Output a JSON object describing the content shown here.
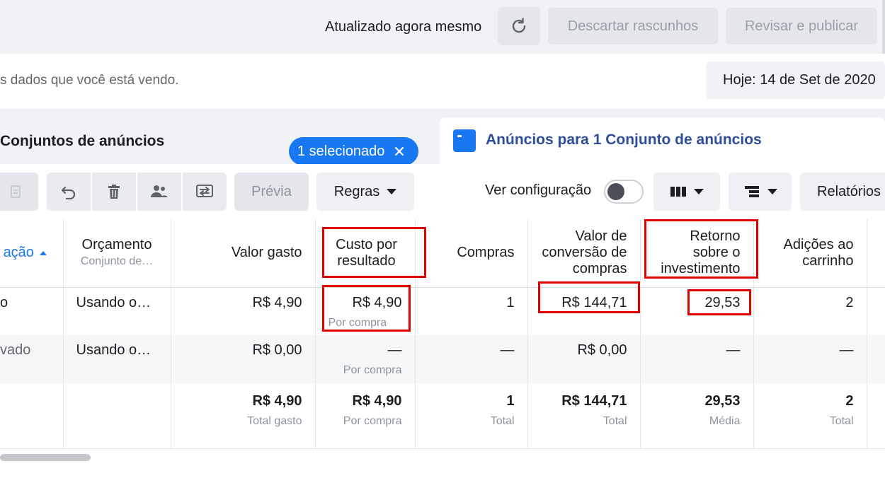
{
  "header": {
    "updated_text": "Atualizado agora mesmo",
    "discard_label": "Descartar rascunhos",
    "publish_label": "Revisar e publicar"
  },
  "info": {
    "text": "s dados que você está vendo.",
    "date_label": "Hoje: 14 de Set de 2020"
  },
  "tabs": {
    "adsets_title": "Conjuntos de anúncios",
    "selected_label": "1 selecionado",
    "ads_title": "Anúncios para 1 Conjunto de anúncios"
  },
  "toolbar": {
    "preview_label": "Prévia",
    "rules_label": "Regras",
    "view_config_label": "Ver configuração",
    "reports_label": "Relatórios"
  },
  "table": {
    "headers": {
      "col0": "ação",
      "budget": "Orçamento",
      "budget_sub": "Conjunto de…",
      "spent": "Valor gasto",
      "cost_per_result": "Custo por resultado",
      "purchases": "Compras",
      "conv_value": "Valor de conversão de compras",
      "roas": "Retorno sobre o investimento",
      "add_to_cart": "Adições ao carrinho"
    },
    "row1": {
      "col0": "o",
      "budget": "Usando o…",
      "spent": "R$ 4,90",
      "cost": "R$ 4,90",
      "cost_sub": "Por compra",
      "purchases": "1",
      "conv_value": "R$ 144,71",
      "roas": "29,53",
      "add_to_cart": "2"
    },
    "row2": {
      "col0": "vado",
      "budget": "Usando o…",
      "spent": "R$ 0,00",
      "cost": "—",
      "cost_sub": "Por compra",
      "purchases": "—",
      "conv_value": "R$ 0,00",
      "roas": "—",
      "add_to_cart": "—"
    },
    "total": {
      "spent": "R$ 4,90",
      "spent_sub": "Total gasto",
      "cost": "R$ 4,90",
      "cost_sub": "Por compra",
      "purchases": "1",
      "purchases_sub": "Total",
      "conv_value": "R$ 144,71",
      "conv_value_sub": "Total",
      "roas": "29,53",
      "roas_sub": "Média",
      "add_to_cart": "2",
      "add_to_cart_sub": "Total"
    }
  },
  "colors": {
    "accent": "#1877f2",
    "highlight": "#e00000",
    "tab_title": "#2d4e9b"
  }
}
